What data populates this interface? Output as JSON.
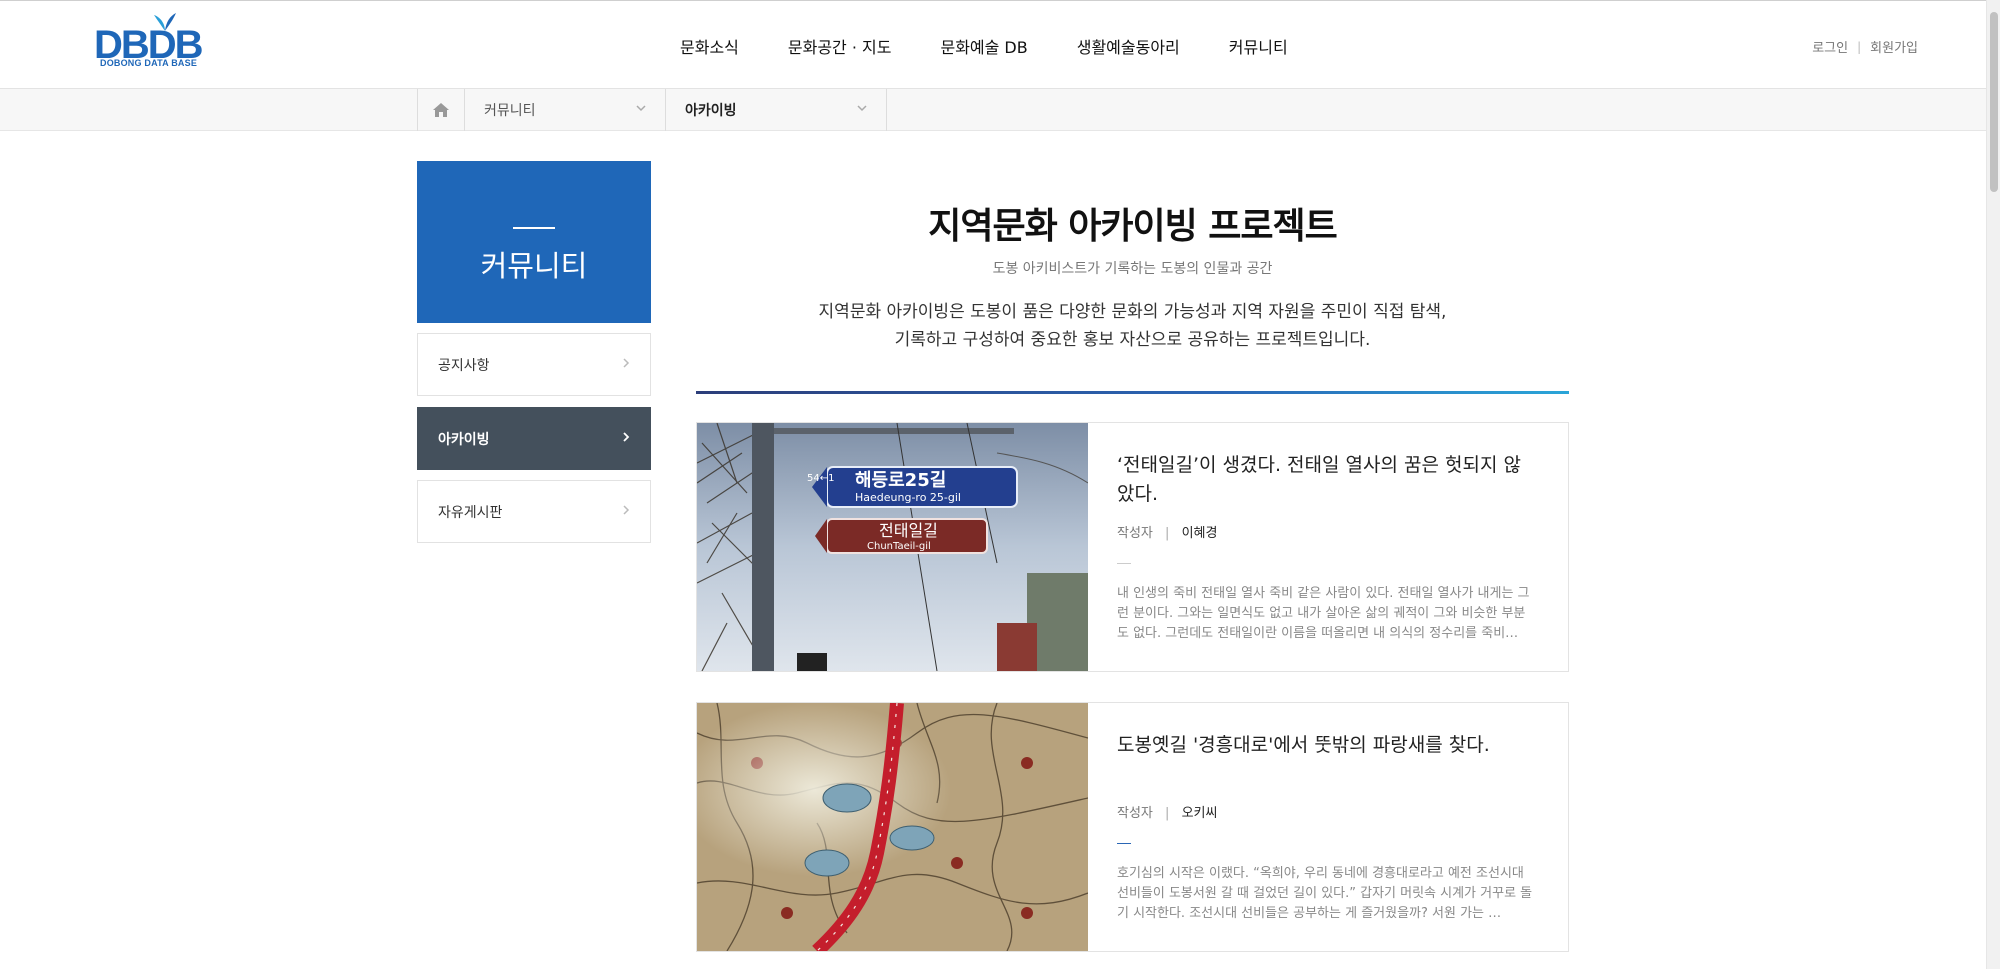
{
  "header": {
    "logo_mark": "DBDB",
    "logo_sub": "DOBONG DATA BASE",
    "nav": [
      "문화소식",
      "문화공간 · 지도",
      "문화예술 DB",
      "생활예술동아리",
      "커뮤니티"
    ],
    "util": {
      "login": "로그인",
      "separator": "|",
      "join": "회원가입"
    }
  },
  "location": {
    "depth1": "커뮤니티",
    "depth2": "아카이빙"
  },
  "sidebar": {
    "title": "커뮤니티",
    "items": [
      {
        "label": "공지사항",
        "active": false
      },
      {
        "label": "아카이빙",
        "active": true
      },
      {
        "label": "자유게시판",
        "active": false
      }
    ]
  },
  "main": {
    "title": "지역문화 아카이빙 프로젝트",
    "subtitle": "도봉 아키비스트가 기록하는 도봉의 인물과 공간",
    "desc_line1": "지역문화 아카이빙은 도봉이 품은 다양한 문화의 가능성과 지역 자원을 주민이 직접 탐색,",
    "desc_line2": "기록하고 구성하여 중요한 홍보 자산으로 공유하는 프로젝트입니다."
  },
  "posts": [
    {
      "title": "‘전태일길’이 생겼다. 전태일 열사의 꿈은 헛되지 않았다.",
      "author_label": "작성자",
      "author_sep": "|",
      "author": "이혜경",
      "excerpt": "   내 인생의 죽비 전태일 열사  죽비 같은 사람이 있다.   전태일 열사가 내게는 그런 분이다.   그와는 일면식도 없고 내가 살아온 삶의 궤적이 그와 비슷한 부분도 없다. 그런데도 전태일이란 이름을 떠올리면 내 의식의 정수리를 죽비…",
      "dash_color": "#cccccc",
      "sign_top": "해등로25길",
      "sign_top_en": "Haedeung-ro 25-gil",
      "sign_top_num": "54←1",
      "sign_bottom": "전태일길",
      "sign_bottom_en": "ChunTaeil-gil"
    },
    {
      "title": "도봉옛길 '경흥대로'에서 뚯밖의 파랑새를 찾다.",
      "author_label": "작성자",
      "author_sep": "|",
      "author": "오키씨",
      "excerpt": "   호기심의 시작은 이랬다.  “옥희야, 우리 동네에 경흥대로라고 예전 조선시대 선비들이 도봉서원 갈 때 걸었던 길이 있다.”  갑자기 머릿속 시계가 거꾸로 돌기 시작한다. 조선시대 선비들은 공부하는 게 즐거웠을까? 서원 가는 …",
      "dash_color": "#2a66b5"
    }
  ],
  "colors": {
    "brand": "#1f67b8",
    "sidebar_active": "#44505c"
  }
}
